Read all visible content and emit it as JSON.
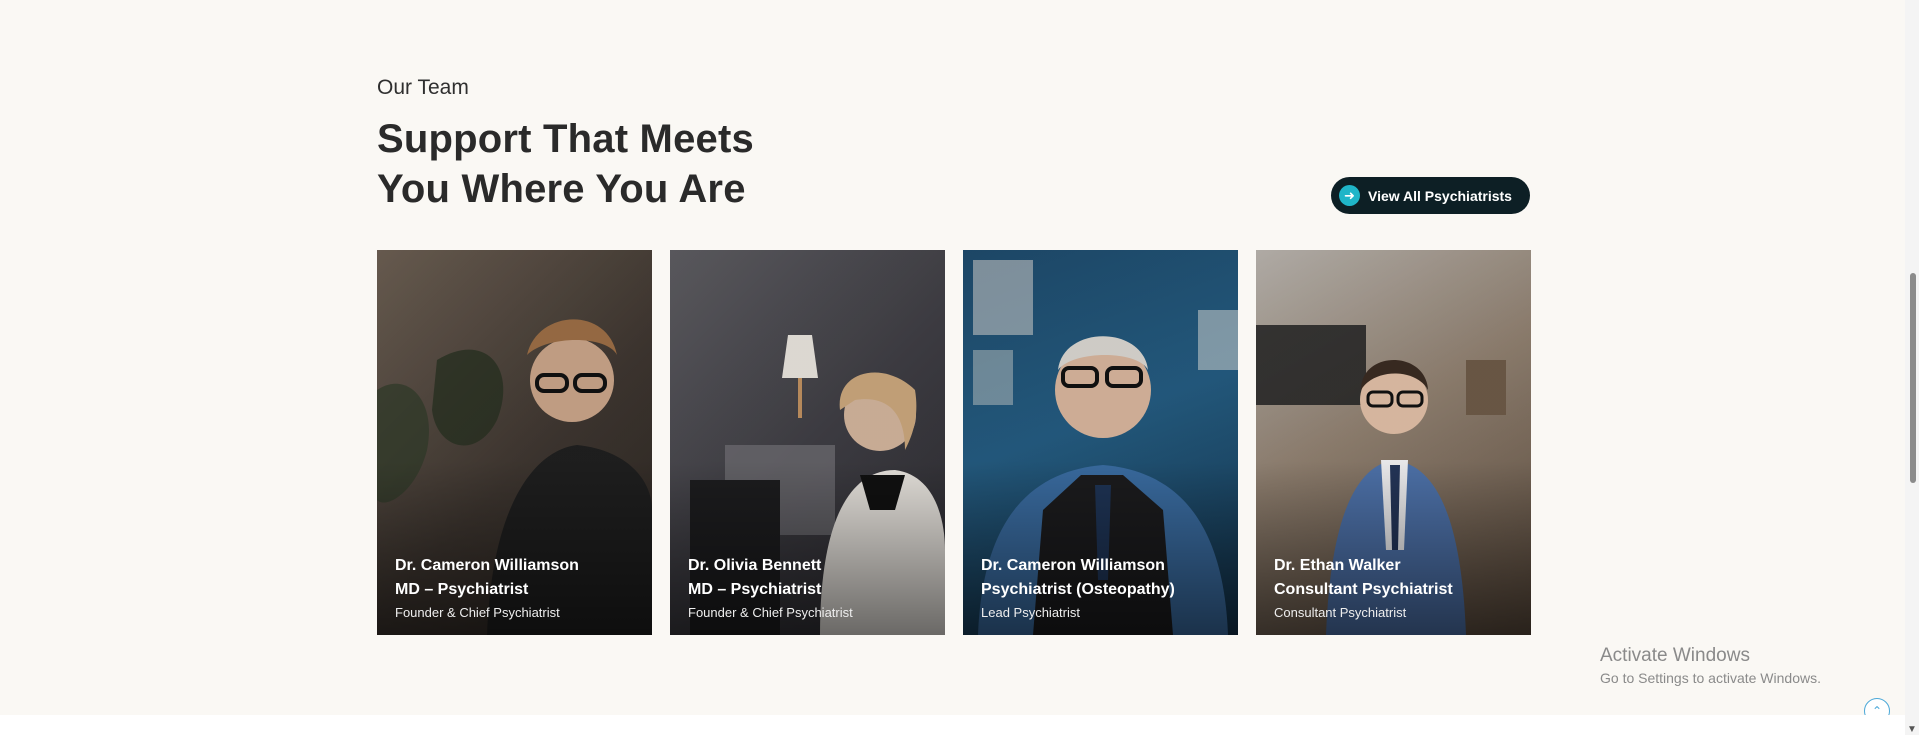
{
  "section": {
    "eyebrow": "Our Team",
    "heading_line1": "Support That Meets",
    "heading_line2": "You Where You Are",
    "cta_label": "View All Psychiatrists",
    "cta_icon": "arrow-right-icon"
  },
  "team": [
    {
      "name": "Dr. Cameron Williamson",
      "title": "MD – Psychiatrist",
      "role": "Founder & Chief Psychiatrist"
    },
    {
      "name": "Dr. Olivia Bennett",
      "title": "MD – Psychiatrist",
      "role": "Founder & Chief Psychiatrist"
    },
    {
      "name": "Dr. Cameron Williamson",
      "title": "Psychiatrist (Osteopathy)",
      "role": "Lead Psychiatrist"
    },
    {
      "name": "Dr. Ethan Walker",
      "title": "Consultant Psychiatrist",
      "role": "Consultant Psychiatrist"
    }
  ],
  "watermark": {
    "line1": "Activate Windows",
    "line2": "Go to Settings to activate Windows."
  },
  "colors": {
    "background": "#faf8f4",
    "cta_bg": "#0d1f25",
    "cta_icon_bg": "#1fb5c8",
    "heading": "#2a2a2a"
  }
}
